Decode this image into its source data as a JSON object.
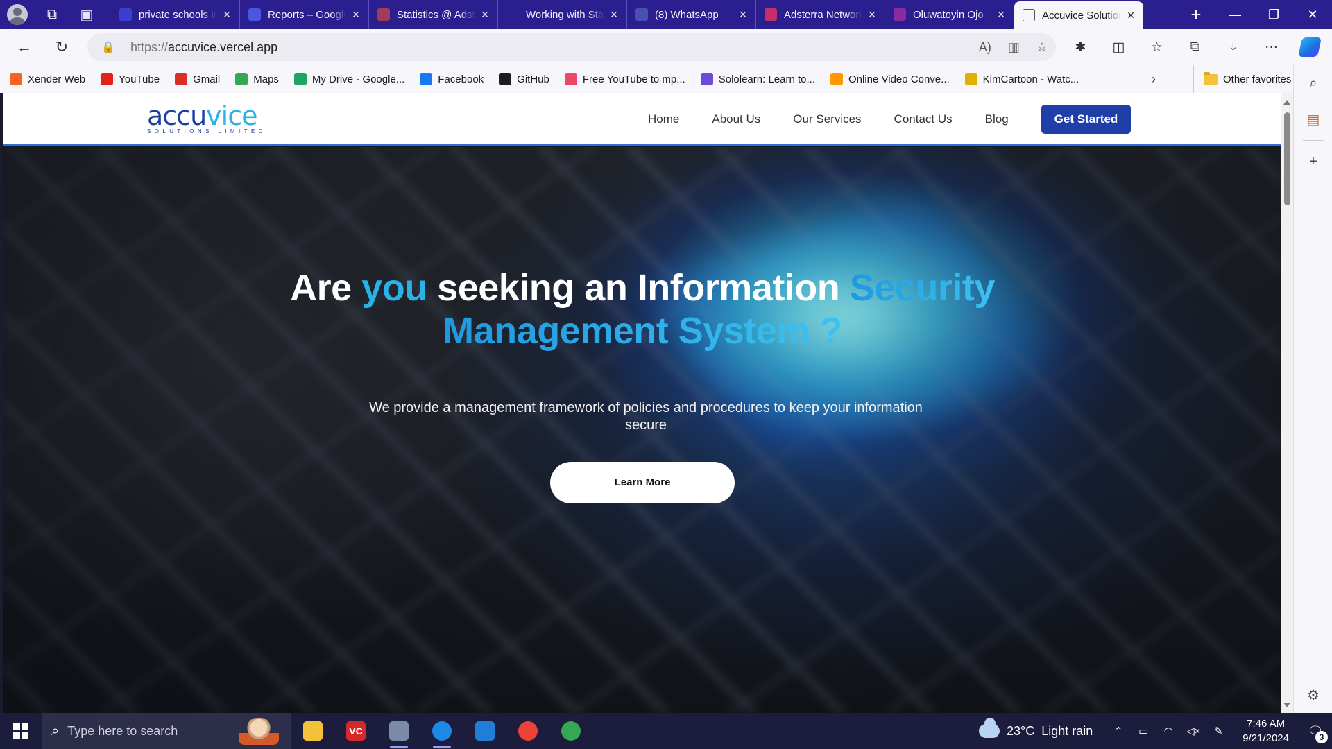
{
  "browser": {
    "tabs": [
      {
        "title": "private schools in",
        "favicon_color": "#3b3fd1",
        "favicon_icon": "search-icon",
        "active": false
      },
      {
        "title": "Reports – Google",
        "favicon_color": "#4a55e0",
        "favicon_icon": "google-analytics-icon",
        "active": false
      },
      {
        "title": "Statistics @ Adsterra",
        "favicon_color": "#a33a5c",
        "favicon_icon": "adsterra-icon",
        "active": false
      },
      {
        "title": "Working with Sta",
        "favicon_color": "#2b1f8f",
        "favicon_icon": "document-icon",
        "active": false
      },
      {
        "title": "(8) WhatsApp",
        "favicon_color": "#4b4fb0",
        "favicon_icon": "whatsapp-icon",
        "active": false
      },
      {
        "title": "Adsterra Network",
        "favicon_color": "#c1306b",
        "favicon_icon": "adsterra-m-icon",
        "active": false
      },
      {
        "title": "Oluwatoyin Ojo",
        "favicon_color": "#8a2b9e",
        "favicon_icon": "profile-icon",
        "active": false
      },
      {
        "title": "Accuvice Solutions",
        "favicon_color": "#ffffff",
        "favicon_icon": "page-icon",
        "active": true
      }
    ],
    "url_scheme": "https://",
    "url_host": "accuvice.vercel.app",
    "favorites": [
      {
        "label": "Xender Web",
        "color": "#f26522"
      },
      {
        "label": "YouTube",
        "color": "#e62117"
      },
      {
        "label": "Gmail",
        "color": "#d93025"
      },
      {
        "label": "Maps",
        "color": "#34a853"
      },
      {
        "label": "My Drive - Google...",
        "color": "#1fa463"
      },
      {
        "label": "Facebook",
        "color": "#1877f2"
      },
      {
        "label": "GitHub",
        "color": "#1d1d1d"
      },
      {
        "label": "Free YouTube to mp...",
        "color": "#e94a67"
      },
      {
        "label": "Sololearn: Learn to...",
        "color": "#6c4bd8"
      },
      {
        "label": "Online Video Conve...",
        "color": "#ff9800"
      },
      {
        "label": "KimCartoon - Watc...",
        "color": "#e0b000"
      }
    ],
    "other_favorites": "Other favorites"
  },
  "site": {
    "logo_word_a": "accu",
    "logo_word_b": "vice",
    "logo_tagline": "SOLUTIONS LIMITED",
    "nav": [
      "Home",
      "About Us",
      "Our Services",
      "Contact Us",
      "Blog"
    ],
    "cta": "Get Started",
    "hero": {
      "t1": "Are ",
      "t2": "you",
      "t3": " seeking an Information ",
      "t4": "Security",
      "t5": "Management System ?",
      "subtitle": "We provide a management framework of policies and procedures to keep your information secure",
      "button": "Learn More"
    }
  },
  "taskbar": {
    "search_placeholder": "Type here to search",
    "apps": [
      {
        "name": "file-explorer",
        "color": "#f3c13a",
        "label": ""
      },
      {
        "name": "vc",
        "color": "#d62828",
        "label": "VC"
      },
      {
        "name": "system-tool",
        "color": "#7a8aa8",
        "label": ""
      },
      {
        "name": "edge",
        "color": "#1e88e5",
        "label": ""
      },
      {
        "name": "vscode",
        "color": "#1f7fd6",
        "label": ""
      },
      {
        "name": "chrome",
        "color": "#ea4335",
        "label": ""
      },
      {
        "name": "chrome-profile",
        "color": "#34a853",
        "label": ""
      }
    ],
    "weather_temp": "23°C",
    "weather_desc": "Light rain",
    "time": "7:46 AM",
    "date": "9/21/2024",
    "notification_count": "3"
  }
}
